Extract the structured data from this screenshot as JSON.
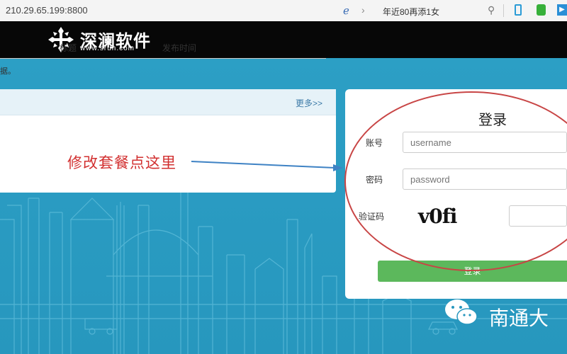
{
  "browser": {
    "url": "210.29.65.199:8800",
    "search_text": "年近80再添1女"
  },
  "header": {
    "logo_text": "深澜软件",
    "logo_sub": "www.srun.com"
  },
  "notice": {
    "more_link": "更多>>",
    "columns": [
      "标题",
      "发布时间"
    ],
    "row_text": "据。"
  },
  "annotation": {
    "text": "修改套餐点这里",
    "color": "#d23030"
  },
  "login": {
    "title": "登录",
    "account_label": "账号",
    "account_placeholder": "username",
    "password_label": "密码",
    "password_placeholder": "password",
    "captcha_label": "验证码",
    "captcha_text": "v0fi",
    "button_label": "登录",
    "button_color": "#5cb85c"
  },
  "watermark": {
    "text": "南通大"
  },
  "colors": {
    "background": "#2a9bc1",
    "header": "#070707"
  }
}
